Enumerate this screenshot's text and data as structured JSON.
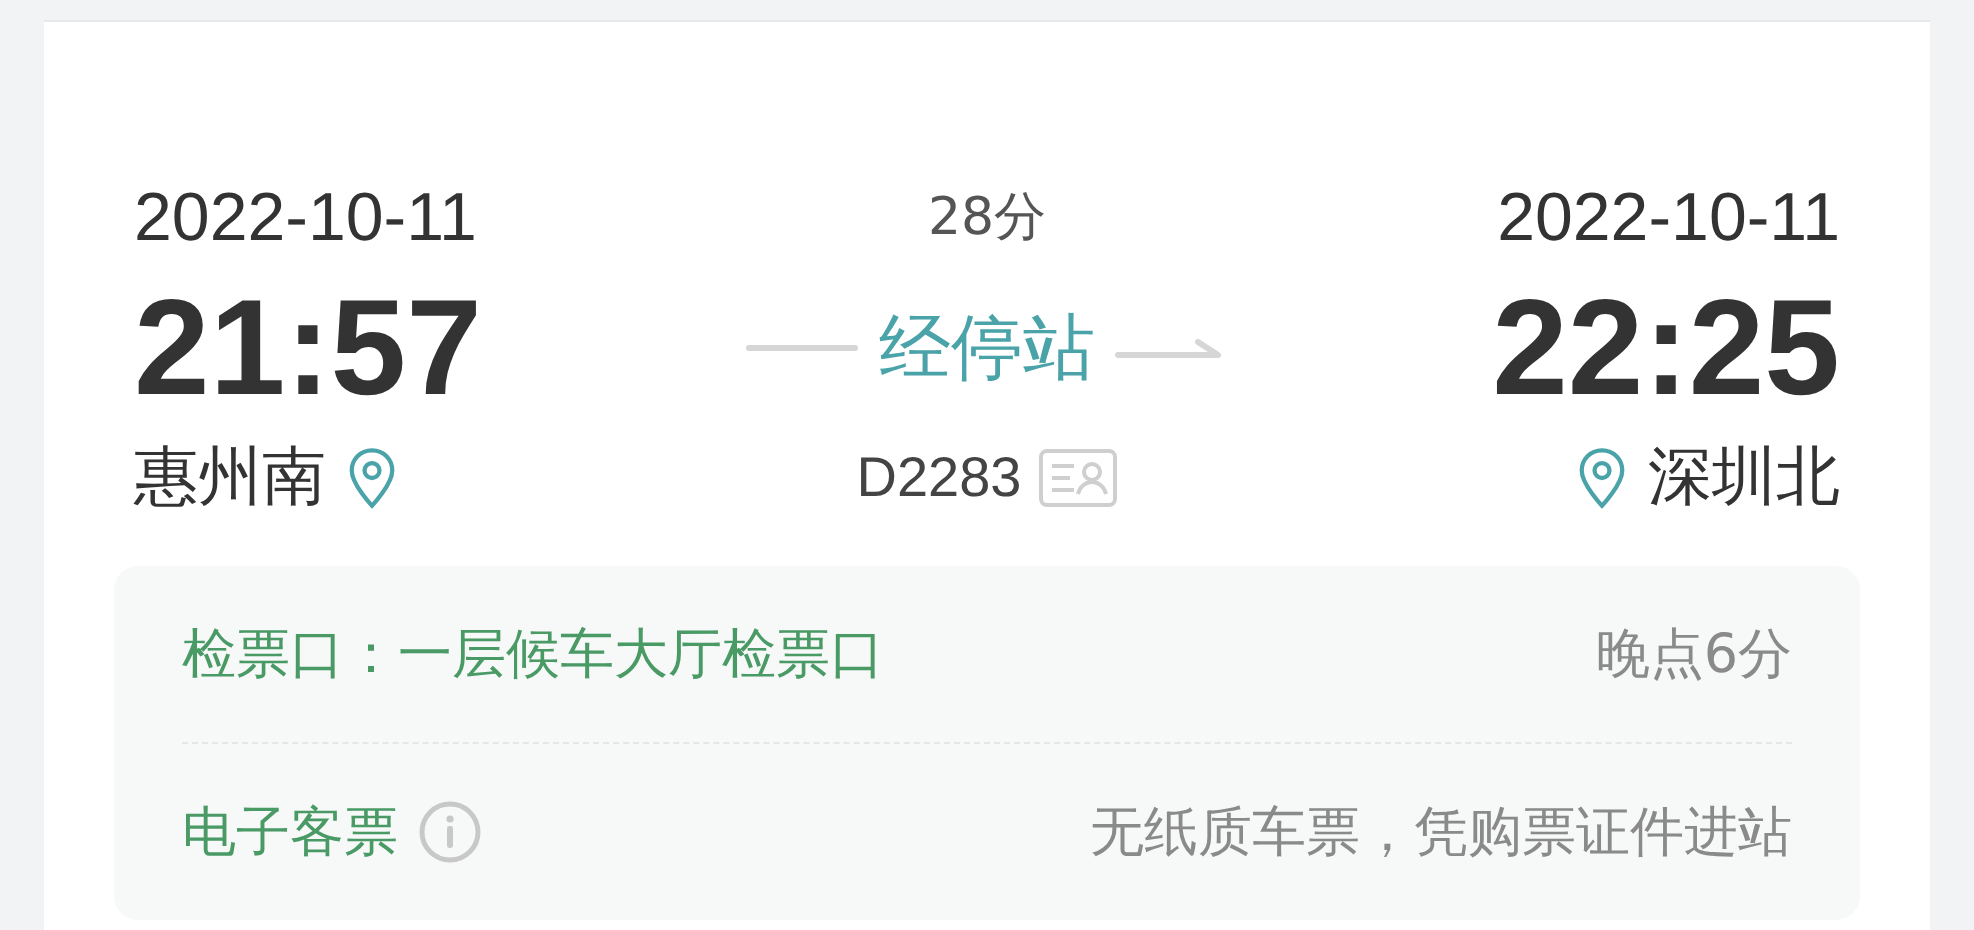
{
  "departure": {
    "date": "2022-10-11",
    "time": "21:57",
    "station": "惠州南"
  },
  "middle": {
    "duration": "28分",
    "stops_link": "经停站",
    "train_number": "D2283"
  },
  "arrival": {
    "date": "2022-10-11",
    "time": "22:25",
    "station": "深圳北"
  },
  "info_rows": [
    {
      "kind": "gate",
      "label": "检票口：一层候车大厅检票口",
      "value": "晚点6分"
    },
    {
      "kind": "eticket",
      "label": "电子客票",
      "value": "无纸质车票，凭购票证件进站"
    }
  ]
}
